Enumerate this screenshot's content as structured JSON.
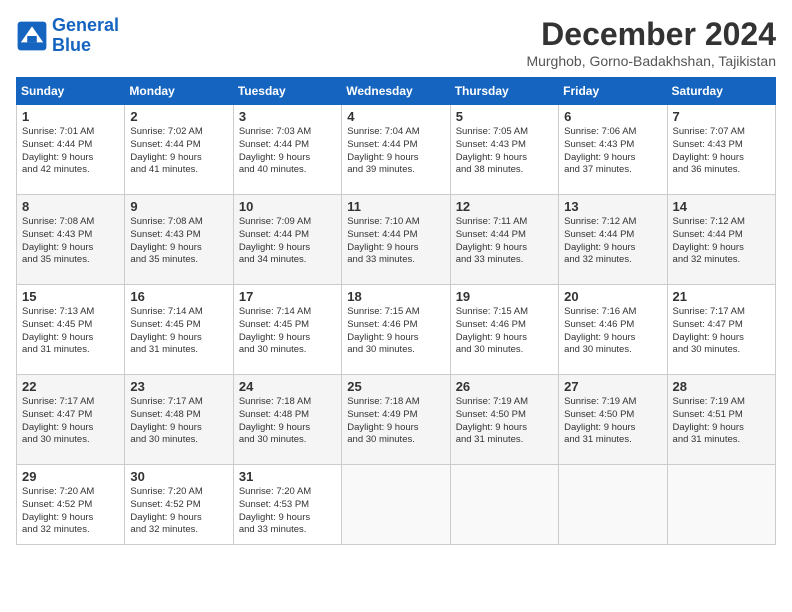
{
  "logo": {
    "line1": "General",
    "line2": "Blue"
  },
  "title": "December 2024",
  "location": "Murghob, Gorno-Badakhshan, Tajikistan",
  "headers": [
    "Sunday",
    "Monday",
    "Tuesday",
    "Wednesday",
    "Thursday",
    "Friday",
    "Saturday"
  ],
  "weeks": [
    [
      {
        "day": "1",
        "info": "Sunrise: 7:01 AM\nSunset: 4:44 PM\nDaylight: 9 hours\nand 42 minutes."
      },
      {
        "day": "2",
        "info": "Sunrise: 7:02 AM\nSunset: 4:44 PM\nDaylight: 9 hours\nand 41 minutes."
      },
      {
        "day": "3",
        "info": "Sunrise: 7:03 AM\nSunset: 4:44 PM\nDaylight: 9 hours\nand 40 minutes."
      },
      {
        "day": "4",
        "info": "Sunrise: 7:04 AM\nSunset: 4:44 PM\nDaylight: 9 hours\nand 39 minutes."
      },
      {
        "day": "5",
        "info": "Sunrise: 7:05 AM\nSunset: 4:43 PM\nDaylight: 9 hours\nand 38 minutes."
      },
      {
        "day": "6",
        "info": "Sunrise: 7:06 AM\nSunset: 4:43 PM\nDaylight: 9 hours\nand 37 minutes."
      },
      {
        "day": "7",
        "info": "Sunrise: 7:07 AM\nSunset: 4:43 PM\nDaylight: 9 hours\nand 36 minutes."
      }
    ],
    [
      {
        "day": "8",
        "info": "Sunrise: 7:08 AM\nSunset: 4:43 PM\nDaylight: 9 hours\nand 35 minutes."
      },
      {
        "day": "9",
        "info": "Sunrise: 7:08 AM\nSunset: 4:43 PM\nDaylight: 9 hours\nand 35 minutes."
      },
      {
        "day": "10",
        "info": "Sunrise: 7:09 AM\nSunset: 4:44 PM\nDaylight: 9 hours\nand 34 minutes."
      },
      {
        "day": "11",
        "info": "Sunrise: 7:10 AM\nSunset: 4:44 PM\nDaylight: 9 hours\nand 33 minutes."
      },
      {
        "day": "12",
        "info": "Sunrise: 7:11 AM\nSunset: 4:44 PM\nDaylight: 9 hours\nand 33 minutes."
      },
      {
        "day": "13",
        "info": "Sunrise: 7:12 AM\nSunset: 4:44 PM\nDaylight: 9 hours\nand 32 minutes."
      },
      {
        "day": "14",
        "info": "Sunrise: 7:12 AM\nSunset: 4:44 PM\nDaylight: 9 hours\nand 32 minutes."
      }
    ],
    [
      {
        "day": "15",
        "info": "Sunrise: 7:13 AM\nSunset: 4:45 PM\nDaylight: 9 hours\nand 31 minutes."
      },
      {
        "day": "16",
        "info": "Sunrise: 7:14 AM\nSunset: 4:45 PM\nDaylight: 9 hours\nand 31 minutes."
      },
      {
        "day": "17",
        "info": "Sunrise: 7:14 AM\nSunset: 4:45 PM\nDaylight: 9 hours\nand 30 minutes."
      },
      {
        "day": "18",
        "info": "Sunrise: 7:15 AM\nSunset: 4:46 PM\nDaylight: 9 hours\nand 30 minutes."
      },
      {
        "day": "19",
        "info": "Sunrise: 7:15 AM\nSunset: 4:46 PM\nDaylight: 9 hours\nand 30 minutes."
      },
      {
        "day": "20",
        "info": "Sunrise: 7:16 AM\nSunset: 4:46 PM\nDaylight: 9 hours\nand 30 minutes."
      },
      {
        "day": "21",
        "info": "Sunrise: 7:17 AM\nSunset: 4:47 PM\nDaylight: 9 hours\nand 30 minutes."
      }
    ],
    [
      {
        "day": "22",
        "info": "Sunrise: 7:17 AM\nSunset: 4:47 PM\nDaylight: 9 hours\nand 30 minutes."
      },
      {
        "day": "23",
        "info": "Sunrise: 7:17 AM\nSunset: 4:48 PM\nDaylight: 9 hours\nand 30 minutes."
      },
      {
        "day": "24",
        "info": "Sunrise: 7:18 AM\nSunset: 4:48 PM\nDaylight: 9 hours\nand 30 minutes."
      },
      {
        "day": "25",
        "info": "Sunrise: 7:18 AM\nSunset: 4:49 PM\nDaylight: 9 hours\nand 30 minutes."
      },
      {
        "day": "26",
        "info": "Sunrise: 7:19 AM\nSunset: 4:50 PM\nDaylight: 9 hours\nand 31 minutes."
      },
      {
        "day": "27",
        "info": "Sunrise: 7:19 AM\nSunset: 4:50 PM\nDaylight: 9 hours\nand 31 minutes."
      },
      {
        "day": "28",
        "info": "Sunrise: 7:19 AM\nSunset: 4:51 PM\nDaylight: 9 hours\nand 31 minutes."
      }
    ],
    [
      {
        "day": "29",
        "info": "Sunrise: 7:20 AM\nSunset: 4:52 PM\nDaylight: 9 hours\nand 32 minutes."
      },
      {
        "day": "30",
        "info": "Sunrise: 7:20 AM\nSunset: 4:52 PM\nDaylight: 9 hours\nand 32 minutes."
      },
      {
        "day": "31",
        "info": "Sunrise: 7:20 AM\nSunset: 4:53 PM\nDaylight: 9 hours\nand 33 minutes."
      },
      {
        "day": "",
        "info": ""
      },
      {
        "day": "",
        "info": ""
      },
      {
        "day": "",
        "info": ""
      },
      {
        "day": "",
        "info": ""
      }
    ]
  ]
}
